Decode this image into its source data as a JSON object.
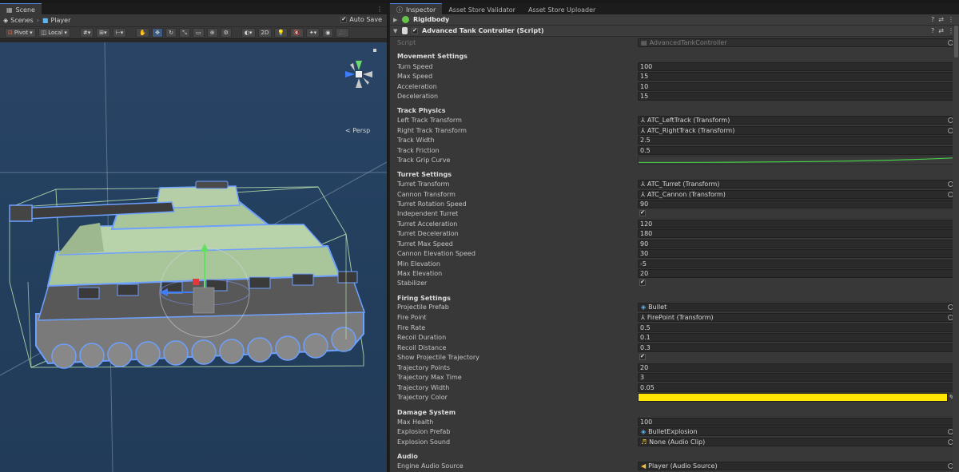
{
  "colors": {
    "accent": "#4f86d9",
    "trajectory": "#ffe600",
    "grid": "#9fb3cb",
    "tank": "#a9c59a",
    "selection_outline": "#6ea0ff"
  },
  "scene": {
    "tab_label": "Scene",
    "breadcrumb": {
      "root": "Scenes",
      "current": "Player"
    },
    "autosave_label": "Auto Save",
    "autosave_checked": true,
    "toolbar": {
      "pivot": "Pivot",
      "local": "Local",
      "mode_2d": "2D"
    },
    "persp_label": "Persp"
  },
  "inspector": {
    "tabs": [
      "Inspector",
      "Asset Store Validator",
      "Asset Store Uploader"
    ],
    "components": [
      {
        "name": "Rigidbody",
        "icon": "rigidbody-icon"
      },
      {
        "name": "Advanced Tank Controller (Script)",
        "icon": "script-icon"
      }
    ],
    "script_row": {
      "label": "Script",
      "value": "AdvancedTankController"
    },
    "sections": {
      "movement": "Movement Settings",
      "track": "Track Physics",
      "turret": "Turret Settings",
      "firing": "Firing Settings",
      "damage": "Damage System",
      "audio": "Audio"
    },
    "fields": {
      "turn_speed": {
        "label": "Turn Speed",
        "value": "100"
      },
      "max_speed": {
        "label": "Max Speed",
        "value": "15"
      },
      "acceleration": {
        "label": "Acceleration",
        "value": "10"
      },
      "deceleration": {
        "label": "Deceleration",
        "value": "15"
      },
      "left_track": {
        "label": "Left Track Transform",
        "value": "ATC_LeftTrack (Transform)"
      },
      "right_track": {
        "label": "Right Track Transform",
        "value": "ATC_RightTrack (Transform)"
      },
      "track_width": {
        "label": "Track Width",
        "value": "2.5"
      },
      "track_friction": {
        "label": "Track Friction",
        "value": "0.5"
      },
      "track_grip_curve": {
        "label": "Track Grip Curve"
      },
      "turret_transform": {
        "label": "Turret Transform",
        "value": "ATC_Turret (Transform)"
      },
      "cannon_transform": {
        "label": "Cannon Transform",
        "value": "ATC_Cannon (Transform)"
      },
      "turret_rotation_speed": {
        "label": "Turret Rotation Speed",
        "value": "90"
      },
      "independent_turret": {
        "label": "Independent Turret",
        "checked": true
      },
      "turret_acceleration": {
        "label": "Turret Acceleration",
        "value": "120"
      },
      "turret_deceleration": {
        "label": "Turret Deceleration",
        "value": "180"
      },
      "turret_max_speed": {
        "label": "Turret Max Speed",
        "value": "90"
      },
      "cannon_elevation_speed": {
        "label": "Cannon Elevation Speed",
        "value": "30"
      },
      "min_elevation": {
        "label": "Min Elevation",
        "value": "-5"
      },
      "max_elevation": {
        "label": "Max Elevation",
        "value": "20"
      },
      "stabilizer": {
        "label": "Stabilizer",
        "checked": true
      },
      "projectile_prefab": {
        "label": "Projectile Prefab",
        "value": "Bullet"
      },
      "fire_point": {
        "label": "Fire Point",
        "value": "FirePoint (Transform)"
      },
      "fire_rate": {
        "label": "Fire Rate",
        "value": "0.5"
      },
      "recoil_duration": {
        "label": "Recoil Duration",
        "value": "0.1"
      },
      "recoil_distance": {
        "label": "Recoil Distance",
        "value": "0.3"
      },
      "show_trajectory": {
        "label": "Show Projectile Trajectory",
        "checked": true
      },
      "trajectory_points": {
        "label": "Trajectory Points",
        "value": "20"
      },
      "trajectory_max_time": {
        "label": "Trajectory Max Time",
        "value": "3"
      },
      "trajectory_width": {
        "label": "Trajectory Width",
        "value": "0.05"
      },
      "trajectory_color": {
        "label": "Trajectory Color"
      },
      "max_health": {
        "label": "Max Health",
        "value": "100"
      },
      "explosion_prefab": {
        "label": "Explosion Prefab",
        "value": "BulletExplosion"
      },
      "explosion_sound": {
        "label": "Explosion Sound",
        "value": "None (Audio Clip)"
      },
      "engine_audio_source": {
        "label": "Engine Audio Source",
        "value": "Player (Audio Source)"
      }
    }
  }
}
